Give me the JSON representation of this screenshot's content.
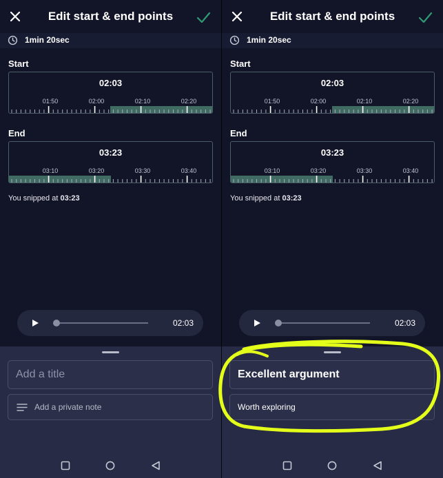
{
  "screens": [
    {
      "title": "Edit start & end points",
      "duration": "1min 20sec",
      "start": {
        "label": "Start",
        "time": "02:03",
        "ticks": [
          "01:50",
          "02:00",
          "02:10",
          "02:20"
        ]
      },
      "end": {
        "label": "End",
        "time": "03:23",
        "ticks": [
          "03:10",
          "03:20",
          "03:30",
          "03:40"
        ]
      },
      "snip_prefix": "You snipped at",
      "snip_time": "03:23",
      "player_time": "02:03",
      "title_placeholder": "Add a title",
      "note_placeholder": "Add a private note"
    },
    {
      "title": "Edit start & end points",
      "duration": "1min 20sec",
      "start": {
        "label": "Start",
        "time": "02:03",
        "ticks": [
          "01:50",
          "02:00",
          "02:10",
          "02:20"
        ]
      },
      "end": {
        "label": "End",
        "time": "03:23",
        "ticks": [
          "03:10",
          "03:20",
          "03:30",
          "03:40"
        ]
      },
      "snip_prefix": "You snipped at",
      "snip_time": "03:23",
      "player_time": "02:03",
      "title_value": "Excellent argument",
      "note_value": "Worth exploring"
    }
  ],
  "colors": {
    "accent_check": "#2f9a74",
    "selection": "#3f6b62",
    "highlight_marker": "#e3ff1a"
  },
  "icons": [
    "close-icon",
    "check-icon",
    "clock-icon",
    "play-icon",
    "lines-icon",
    "nav-square-icon",
    "nav-circle-icon",
    "nav-triangle-icon"
  ]
}
